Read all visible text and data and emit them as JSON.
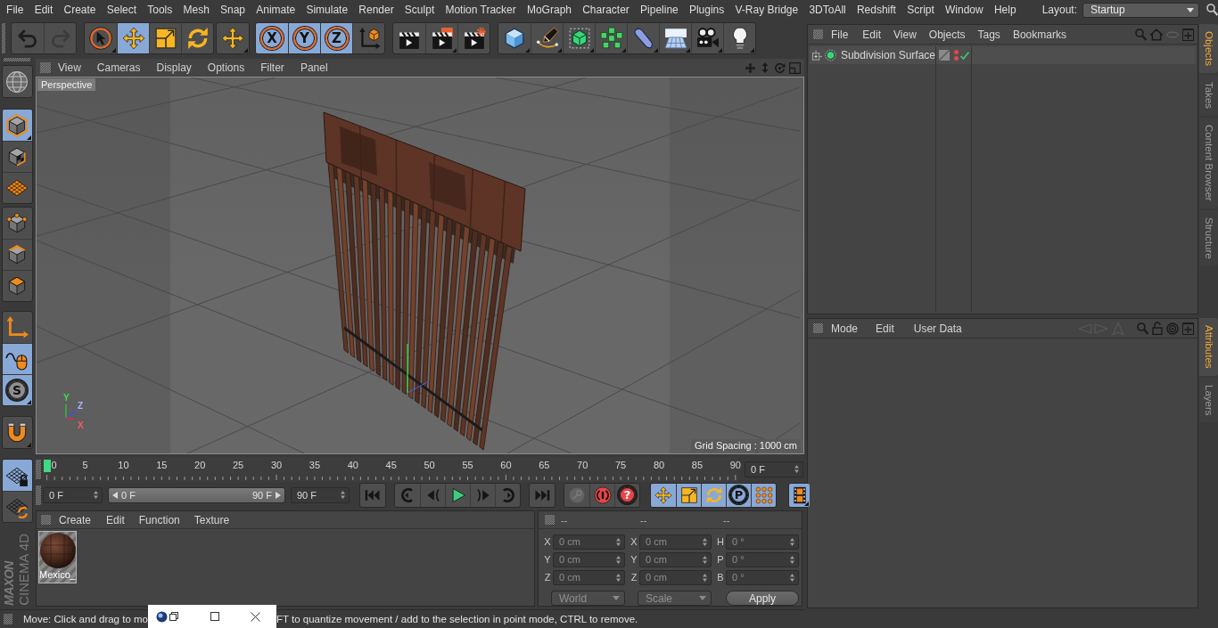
{
  "menu_bar": {
    "items": [
      "File",
      "Edit",
      "Create",
      "Select",
      "Tools",
      "Mesh",
      "Snap",
      "Animate",
      "Simulate",
      "Render",
      "Sculpt",
      "Motion Tracker",
      "MoGraph",
      "Character",
      "Pipeline",
      "Plugins",
      "V-Ray Bridge",
      "3DToAll",
      "Redshift",
      "Script",
      "Window",
      "Help"
    ],
    "layout_label": "Layout:",
    "layout_value": "Startup"
  },
  "toolbar": [
    [
      {
        "kind": "undo",
        "selected": false,
        "disabled": false,
        "submenu": false
      },
      {
        "kind": "redo",
        "selected": false,
        "disabled": true,
        "submenu": false
      }
    ],
    [
      {
        "kind": "select",
        "selected": false,
        "disabled": false,
        "submenu": true
      },
      {
        "kind": "move",
        "selected": true,
        "disabled": false,
        "submenu": false
      },
      {
        "kind": "scale",
        "selected": false,
        "disabled": false,
        "submenu": false
      },
      {
        "kind": "rotate",
        "selected": false,
        "disabled": false,
        "submenu": false
      }
    ],
    [
      {
        "kind": "move",
        "selected": false,
        "disabled": false,
        "submenu": true
      }
    ],
    [
      {
        "kind": "axis",
        "label": "X",
        "selected": true,
        "disabled": false,
        "submenu": false
      },
      {
        "kind": "axis",
        "label": "Y",
        "selected": true,
        "disabled": false,
        "submenu": false
      },
      {
        "kind": "axis",
        "label": "Z",
        "selected": true,
        "disabled": false,
        "submenu": false
      },
      {
        "kind": "coords",
        "selected": false,
        "disabled": false,
        "submenu": false
      }
    ],
    [
      {
        "kind": "render",
        "selected": false,
        "disabled": false,
        "submenu": false
      },
      {
        "kind": "viewer",
        "selected": false,
        "disabled": false,
        "submenu": true
      },
      {
        "kind": "settings",
        "selected": false,
        "disabled": false,
        "submenu": false
      }
    ],
    [
      {
        "kind": "cube",
        "selected": false,
        "disabled": false,
        "submenu": true
      },
      {
        "kind": "pen",
        "selected": false,
        "disabled": false,
        "submenu": true
      },
      {
        "kind": "subdivision",
        "selected": false,
        "disabled": false,
        "submenu": true
      },
      {
        "kind": "cloner",
        "selected": false,
        "disabled": false,
        "submenu": true
      },
      {
        "kind": "deformer",
        "selected": false,
        "disabled": false,
        "submenu": true
      },
      {
        "kind": "floor",
        "selected": false,
        "disabled": false,
        "submenu": true
      },
      {
        "kind": "camera",
        "selected": false,
        "disabled": false,
        "submenu": true
      },
      {
        "kind": "light",
        "selected": false,
        "disabled": false,
        "submenu": true
      }
    ]
  ],
  "left_toolbar": [
    [
      {
        "kind": "editable",
        "selected": false,
        "submenu": false
      }
    ],
    [
      {
        "kind": "model",
        "selected": true,
        "submenu": true
      },
      {
        "kind": "texture",
        "selected": false,
        "submenu": false
      },
      {
        "kind": "workplane",
        "selected": false,
        "submenu": false
      }
    ],
    [
      {
        "kind": "points",
        "selected": false,
        "submenu": false
      },
      {
        "kind": "edges",
        "selected": false,
        "submenu": false
      },
      {
        "kind": "polygons",
        "selected": false,
        "submenu": false
      }
    ],
    [
      {
        "kind": "axes",
        "selected": false,
        "submenu": false
      },
      {
        "kind": "tweak",
        "selected": true,
        "submenu": false
      },
      {
        "kind": "solo",
        "label": "S",
        "selected": true,
        "submenu": true
      }
    ],
    [
      {
        "kind": "snap",
        "selected": false,
        "submenu": true
      }
    ],
    [
      {
        "kind": "worklock",
        "selected": true,
        "submenu": false
      },
      {
        "kind": "workrotate",
        "selected": false,
        "submenu": false
      }
    ]
  ],
  "logo": {
    "brand": "MAXON",
    "product": "CINEMA 4D"
  },
  "viewport": {
    "menu": [
      "View",
      "Cameras",
      "Display",
      "Options",
      "Filter",
      "Panel"
    ],
    "camera": "Perspective",
    "grid_spacing": "Grid Spacing : 1000 cm",
    "axis_labels": {
      "y": "Y",
      "z": "Z",
      "x": "X"
    }
  },
  "timeline": {
    "ticks": [
      "0",
      "5",
      "10",
      "15",
      "20",
      "25",
      "30",
      "35",
      "40",
      "45",
      "50",
      "55",
      "60",
      "65",
      "70",
      "75",
      "80",
      "85",
      "90"
    ],
    "level": 0,
    "current_frame": "0 F"
  },
  "playback": {
    "start_frame": "0 F",
    "range": {
      "start": "0 F",
      "end": "90 F",
      "level": 1
    },
    "end_frame": "90 F",
    "groups": [
      [
        {
          "kind": "start",
          "selected": false,
          "disabled": false,
          "submenu": false
        }
      ],
      [
        {
          "kind": "prevkey",
          "selected": false,
          "disabled": false,
          "submenu": false
        },
        {
          "kind": "prevframe",
          "selected": false,
          "disabled": false,
          "submenu": false
        },
        {
          "kind": "play",
          "selected": false,
          "disabled": false,
          "submenu": false
        },
        {
          "kind": "nextframe",
          "selected": false,
          "disabled": false,
          "submenu": false
        },
        {
          "kind": "nextkey",
          "selected": false,
          "disabled": false,
          "submenu": false
        }
      ],
      [
        {
          "kind": "end",
          "selected": false,
          "disabled": false,
          "submenu": false
        }
      ],
      [
        {
          "kind": "record",
          "selected": false,
          "disabled": true,
          "submenu": false
        },
        {
          "kind": "autokey",
          "selected": false,
          "disabled": false,
          "submenu": false
        },
        {
          "kind": "keysel",
          "label": "?",
          "selected": false,
          "disabled": false,
          "submenu": false
        }
      ],
      [
        {
          "kind": "position",
          "selected": true,
          "disabled": false,
          "submenu": false
        },
        {
          "kind": "scale",
          "selected": true,
          "disabled": false,
          "submenu": false
        },
        {
          "kind": "rotate",
          "selected": true,
          "disabled": false,
          "submenu": false
        },
        {
          "kind": "param",
          "label": "P",
          "selected": true,
          "disabled": false,
          "submenu": false
        },
        {
          "kind": "pla",
          "selected": true,
          "disabled": false,
          "submenu": false
        }
      ],
      [
        {
          "kind": "timeline",
          "selected": true,
          "disabled": false,
          "submenu": true
        }
      ]
    ]
  },
  "material_manager": {
    "menu": [
      "Create",
      "Edit",
      "Function",
      "Texture"
    ],
    "materials": [
      {
        "name": "Mexico_",
        "selected": true
      }
    ]
  },
  "coordinates": {
    "headers": [
      "--",
      "--",
      "--"
    ],
    "disabled": true,
    "rows": [
      {
        "position_axis": "X",
        "position": "0 cm",
        "size_axis": "X",
        "size": "0 cm",
        "rotation_axis": "H",
        "rotation": "0 °"
      },
      {
        "position_axis": "Y",
        "position": "0 cm",
        "size_axis": "Y",
        "size": "0 cm",
        "rotation_axis": "P",
        "rotation": "0 °"
      },
      {
        "position_axis": "Z",
        "position": "0 cm",
        "size_axis": "Z",
        "size": "0 cm",
        "rotation_axis": "B",
        "rotation": "0 °"
      }
    ],
    "space": "World",
    "mode": "Scale",
    "apply": "Apply"
  },
  "object_manager": {
    "menu": [
      "File",
      "Edit",
      "View",
      "Objects",
      "Tags",
      "Bookmarks"
    ],
    "objects": [
      {
        "name": "Subdivision Surface",
        "selected": false,
        "expanded": false,
        "editor_visible": false,
        "render_visible": false,
        "enabled": true
      }
    ]
  },
  "side_tabs_top": [
    {
      "label": "Objects",
      "selected": true
    },
    {
      "label": "Takes",
      "selected": false
    },
    {
      "label": "Content Browser",
      "selected": false
    },
    {
      "label": "Structure",
      "selected": false
    }
  ],
  "attribute_manager": {
    "menu": [
      "Mode",
      "Edit",
      "User Data"
    ]
  },
  "side_tabs_bottom": [
    {
      "label": "Attributes",
      "selected": true
    },
    {
      "label": "Layers",
      "selected": false
    }
  ],
  "status_bar": {
    "text_before": "Move: Click and drag to mo",
    "text_after": "FT to quantize movement / add to the selection in point mode, CTRL to remove."
  }
}
